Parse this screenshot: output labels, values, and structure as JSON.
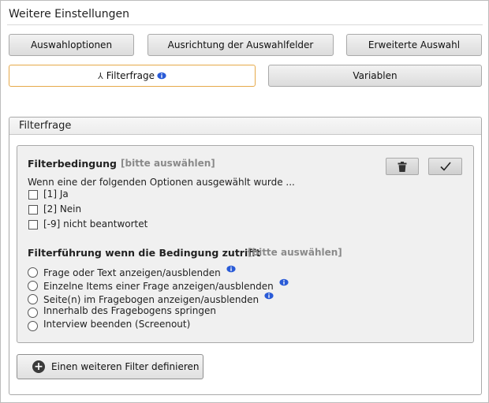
{
  "page": {
    "title": "Weitere Einstellungen"
  },
  "toolbar": {
    "row1": [
      "Auswahloptionen",
      "Ausrichtung der Auswahlfelder",
      "Erweiterte Auswahl"
    ],
    "filter_label": "Filterfrage",
    "variables_label": "Variablen"
  },
  "section": {
    "title": "Filterfrage",
    "condition": {
      "heading": "Filterbedingung",
      "hint": "[bitte auswählen]",
      "intro": "Wenn eine der folgenden Optionen ausgewählt wurde ...",
      "options": [
        {
          "label": "[1] Ja",
          "checked": false
        },
        {
          "label": "[2] Nein",
          "checked": false
        },
        {
          "label": "[-9] nicht beantwortet",
          "checked": false
        }
      ],
      "delete_icon": "trash-icon",
      "confirm_icon": "checkmark-icon"
    },
    "routing": {
      "heading": "Filterführung wenn die Bedingung zutrifft",
      "hint": "[bitte auswählen]",
      "options": [
        {
          "label": "Frage oder Text anzeigen/ausblenden",
          "info": true
        },
        {
          "label": "Einzelne Items einer Frage anzeigen/ausblenden",
          "info": true
        },
        {
          "label": "Seite(n) im Fragebogen anzeigen/ausblenden",
          "info": true
        },
        {
          "label": "Innerhalb des Fragebogens springen",
          "info": false
        },
        {
          "label": "Interview beenden (Screenout)",
          "info": false
        }
      ]
    },
    "add_filter_label": "Einen weiteren Filter definieren"
  },
  "colors": {
    "active_border": "#e6a94a",
    "info_blue": "#2a5bd7",
    "hint_gray": "#8a8a8a"
  }
}
